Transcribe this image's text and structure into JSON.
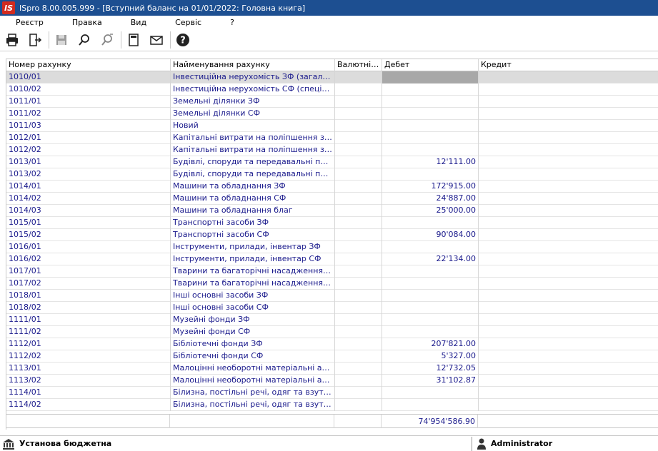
{
  "window": {
    "logo_text": "IS",
    "title": "ISpro 8.00.005.999 - [Вступний баланс на 01/01/2022: Головна книга]"
  },
  "menu": [
    "Реєстр",
    "Правка",
    "Вид",
    "Сервіс",
    "?"
  ],
  "toolbar_icons": [
    "printer-icon",
    "exit-icon",
    "save-icon",
    "find-icon",
    "find-next-icon",
    "calculator-icon",
    "mail-icon",
    "help-icon"
  ],
  "table": {
    "headers": {
      "account": "Номер рахунку",
      "name": "Найменування рахунку",
      "currency": "Валютніс...",
      "debit": "Дебет",
      "credit": "Кредит"
    },
    "rows": [
      {
        "account": "1010/01",
        "name": "Інвестиційна нерухомість ЗФ (загальни...",
        "currency": "",
        "debit": "",
        "credit": ""
      },
      {
        "account": "1010/02",
        "name": "Інвестиційна нерухомість СФ (спеціал...",
        "currency": "",
        "debit": "",
        "credit": ""
      },
      {
        "account": "1011/01",
        "name": "Земельні ділянки ЗФ",
        "currency": "",
        "debit": "",
        "credit": ""
      },
      {
        "account": "1011/02",
        "name": "Земельні ділянки СФ",
        "currency": "",
        "debit": "",
        "credit": ""
      },
      {
        "account": "1011/03",
        "name": "Новий",
        "currency": "",
        "debit": "",
        "credit": ""
      },
      {
        "account": "1012/01",
        "name": "Капітальні витрати на поліпшення земе...",
        "currency": "",
        "debit": "",
        "credit": ""
      },
      {
        "account": "1012/02",
        "name": "Капітальні витрати на поліпшення земе...",
        "currency": "",
        "debit": "",
        "credit": ""
      },
      {
        "account": "1013/01",
        "name": "Будівлі, споруди та передавальні прис...",
        "currency": "",
        "debit": "12'111.00",
        "credit": ""
      },
      {
        "account": "1013/02",
        "name": "Будівлі, споруди та передавальні прис...",
        "currency": "",
        "debit": "",
        "credit": ""
      },
      {
        "account": "1014/01",
        "name": "Машини та обладнання ЗФ",
        "currency": "",
        "debit": "172'915.00",
        "credit": ""
      },
      {
        "account": "1014/02",
        "name": "Машини та обладнання СФ",
        "currency": "",
        "debit": "24'887.00",
        "credit": ""
      },
      {
        "account": "1014/03",
        "name": "Машини та обладнання благ",
        "currency": "",
        "debit": "25'000.00",
        "credit": ""
      },
      {
        "account": "1015/01",
        "name": "Транспортні засоби ЗФ",
        "currency": "",
        "debit": "",
        "credit": ""
      },
      {
        "account": "1015/02",
        "name": "Транспортні засоби СФ",
        "currency": "",
        "debit": "90'084.00",
        "credit": ""
      },
      {
        "account": "1016/01",
        "name": "Інструменти, прилади, інвентар ЗФ",
        "currency": "",
        "debit": "",
        "credit": ""
      },
      {
        "account": "1016/02",
        "name": "Інструменти, прилади, інвентар СФ",
        "currency": "",
        "debit": "22'134.00",
        "credit": ""
      },
      {
        "account": "1017/01",
        "name": "Тварини та багаторічні насадження ЗФ",
        "currency": "",
        "debit": "",
        "credit": ""
      },
      {
        "account": "1017/02",
        "name": "Тварини та багаторічні насадження СФ",
        "currency": "",
        "debit": "",
        "credit": ""
      },
      {
        "account": "1018/01",
        "name": "Інші основні засоби ЗФ",
        "currency": "",
        "debit": "",
        "credit": ""
      },
      {
        "account": "1018/02",
        "name": "Інші основні засоби СФ",
        "currency": "",
        "debit": "",
        "credit": ""
      },
      {
        "account": "1111/01",
        "name": "Музейні фонди ЗФ",
        "currency": "",
        "debit": "",
        "credit": ""
      },
      {
        "account": "1111/02",
        "name": "Музейні фонди СФ",
        "currency": "",
        "debit": "",
        "credit": ""
      },
      {
        "account": "1112/01",
        "name": "Бібліотечні фонди ЗФ",
        "currency": "",
        "debit": "207'821.00",
        "credit": ""
      },
      {
        "account": "1112/02",
        "name": "Бібліотечні фонди СФ",
        "currency": "",
        "debit": "5'327.00",
        "credit": ""
      },
      {
        "account": "1113/01",
        "name": "Малоцінні необоротні матеріальні акти...",
        "currency": "",
        "debit": "12'732.05",
        "credit": ""
      },
      {
        "account": "1113/02",
        "name": "Малоцінні необоротні матеріальні акти...",
        "currency": "",
        "debit": "31'102.87",
        "credit": ""
      },
      {
        "account": "1114/01",
        "name": "Білизна, постільні речі, одяг та взуття ...",
        "currency": "",
        "debit": "",
        "credit": ""
      },
      {
        "account": "1114/02",
        "name": "Білизна, постільні речі, одяг та взуття ...",
        "currency": "",
        "debit": "",
        "credit": ""
      }
    ],
    "total_debit": "74'954'586.90"
  },
  "status": {
    "organization": "Установа бюджетна",
    "user": "Administrator"
  }
}
